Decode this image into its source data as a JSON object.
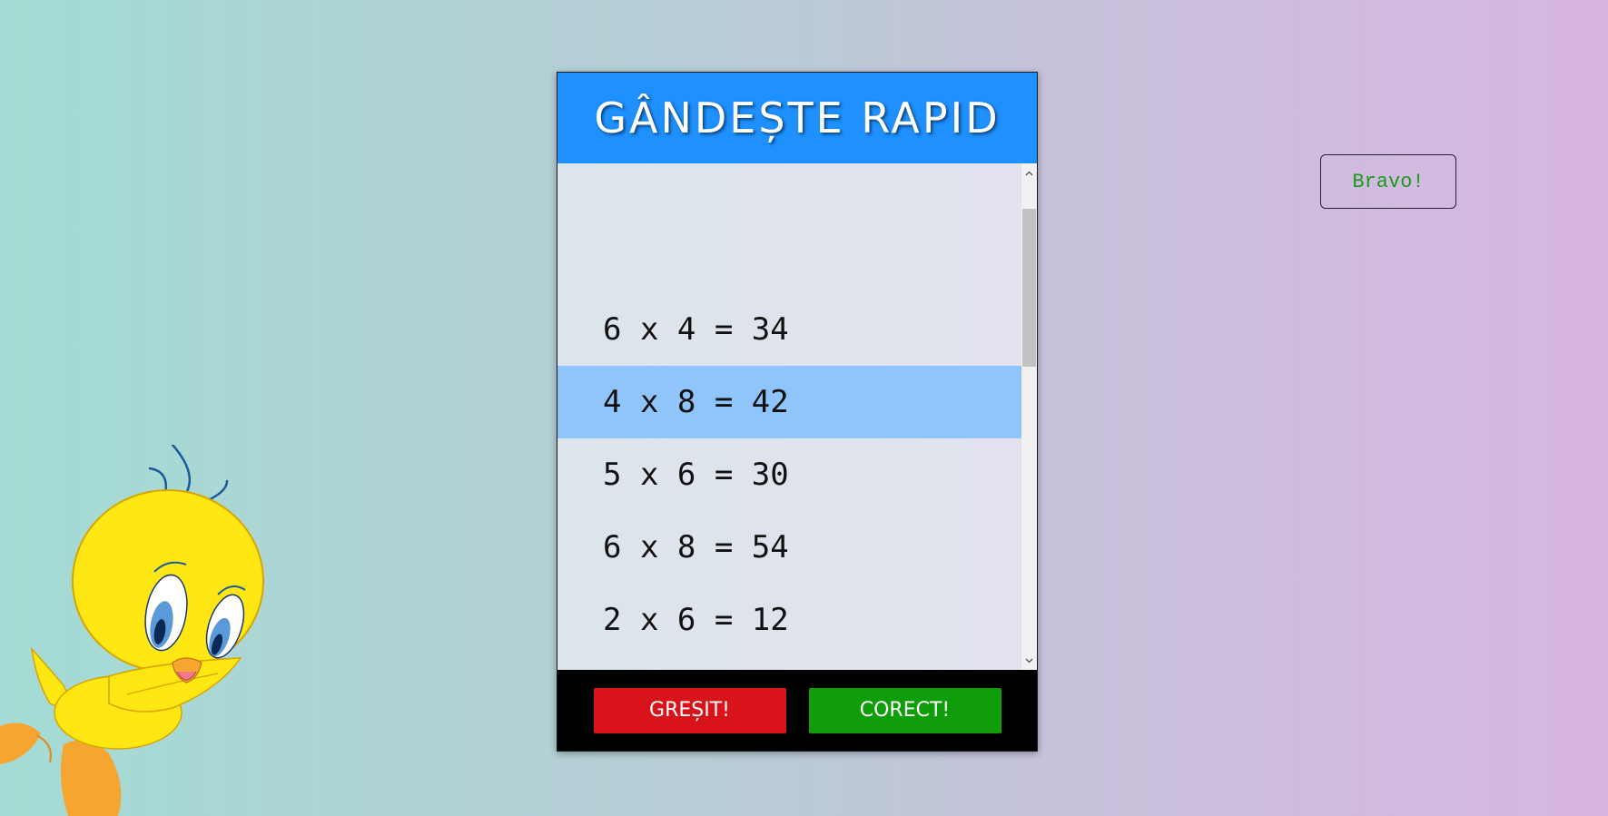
{
  "game": {
    "title": "GÂNDEȘTE RAPID",
    "equations": [
      {
        "text": "6 x 4 = 34",
        "selected": false
      },
      {
        "text": "4 x 8 = 42",
        "selected": true
      },
      {
        "text": "5 x 6 = 30",
        "selected": false
      },
      {
        "text": "6 x 8 = 54",
        "selected": false
      },
      {
        "text": "2 x 6 = 12",
        "selected": false
      }
    ],
    "buttons": {
      "wrong_label": "GREȘIT!",
      "correct_label": "CORECT!"
    }
  },
  "feedback": {
    "message": "Bravo!"
  },
  "colors": {
    "header": "#1e90ff",
    "selected_row": "#8fc5fb",
    "wrong_button": "#d8141a",
    "correct_button": "#0f9e0a",
    "feedback_text": "#1b9a1b"
  },
  "icons": {
    "scroll_up": "chevron-up-icon",
    "scroll_down": "chevron-down-icon",
    "mascot": "yellow-bird-illustration"
  }
}
